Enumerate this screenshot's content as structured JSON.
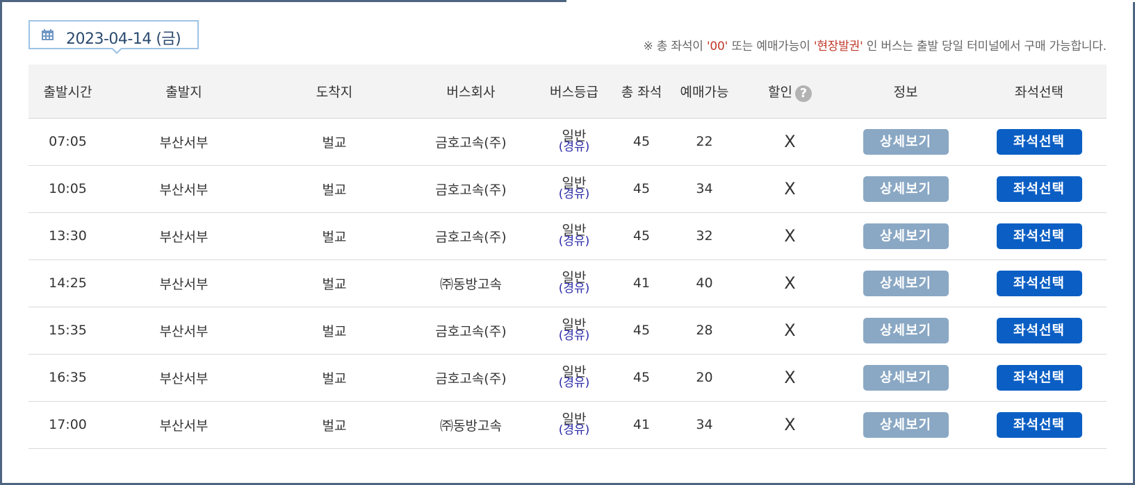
{
  "date": {
    "label": "2023-04-14 (금)",
    "icon": "calendar-icon"
  },
  "notice": {
    "prefix": "※ 총 좌석이 ",
    "q1": "'00'",
    "mid": " 또는 예매가능이 ",
    "q2": "'현장발권'",
    "suffix": " 인 버스는 출발 당일 터미널에서 구매 가능합니다."
  },
  "columns": {
    "depart_time": "출발시간",
    "origin": "출발지",
    "destination": "도착지",
    "company": "버스회사",
    "grade": "버스등급",
    "total_seats": "총 좌석",
    "available": "예매가능",
    "discount": "할인",
    "info": "정보",
    "seat_select": "좌석선택"
  },
  "help_icon": "?",
  "buttons": {
    "detail": "상세보기",
    "seat": "좌석선택"
  },
  "colors": {
    "frame": "#4d6580",
    "date_border": "#9dc3e4",
    "notice_highlight": "#c0392b",
    "grade_sub": "#2a2aa8",
    "detail_button": "#8aa8c4",
    "seat_button": "#0b5fc4"
  },
  "rows": [
    {
      "time": "07:05",
      "origin": "부산서부",
      "destination": "벌교",
      "company": "금호고속(주)",
      "grade": "일반",
      "grade_sub": "(경유)",
      "total": "45",
      "available": "22",
      "discount": "X"
    },
    {
      "time": "10:05",
      "origin": "부산서부",
      "destination": "벌교",
      "company": "금호고속(주)",
      "grade": "일반",
      "grade_sub": "(경유)",
      "total": "45",
      "available": "34",
      "discount": "X"
    },
    {
      "time": "13:30",
      "origin": "부산서부",
      "destination": "벌교",
      "company": "금호고속(주)",
      "grade": "일반",
      "grade_sub": "(경유)",
      "total": "45",
      "available": "32",
      "discount": "X"
    },
    {
      "time": "14:25",
      "origin": "부산서부",
      "destination": "벌교",
      "company": "㈜동방고속",
      "grade": "일반",
      "grade_sub": "(경유)",
      "total": "41",
      "available": "40",
      "discount": "X"
    },
    {
      "time": "15:35",
      "origin": "부산서부",
      "destination": "벌교",
      "company": "금호고속(주)",
      "grade": "일반",
      "grade_sub": "(경유)",
      "total": "45",
      "available": "28",
      "discount": "X"
    },
    {
      "time": "16:35",
      "origin": "부산서부",
      "destination": "벌교",
      "company": "금호고속(주)",
      "grade": "일반",
      "grade_sub": "(경유)",
      "total": "45",
      "available": "20",
      "discount": "X"
    },
    {
      "time": "17:00",
      "origin": "부산서부",
      "destination": "벌교",
      "company": "㈜동방고속",
      "grade": "일반",
      "grade_sub": "(경유)",
      "total": "41",
      "available": "34",
      "discount": "X"
    }
  ]
}
